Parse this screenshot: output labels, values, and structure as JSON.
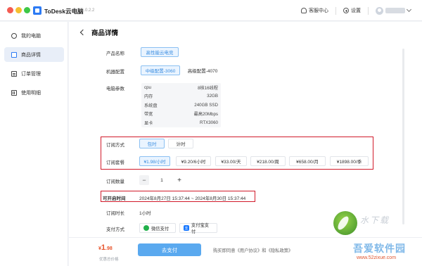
{
  "titlebar": {
    "app_name": "ToDesk云电脑",
    "version": "V1.0.2.2",
    "support": "客服中心",
    "settings": "设置"
  },
  "sidebar": {
    "items": [
      {
        "label": "我的电脑",
        "icon": "user-icon"
      },
      {
        "label": "商品详情",
        "icon": "detail-icon",
        "active": true
      },
      {
        "label": "订单管理",
        "icon": "order-icon"
      },
      {
        "label": "使用明细",
        "icon": "usage-icon"
      }
    ]
  },
  "page": {
    "title": "商品详情",
    "product_name_label": "产品名称",
    "product_name_value": "高性能云电竞",
    "machine_config_label": "机器配置",
    "config_options": [
      "中级配置-3060",
      "高级配置-4070"
    ],
    "selected_config": "中级配置-3060",
    "params_label": "电脑参数",
    "params": [
      {
        "name": "cpu",
        "value": "8核16线程"
      },
      {
        "name": "内存",
        "value": "32GB"
      },
      {
        "name": "系统盘",
        "value": "240GB SSD"
      },
      {
        "name": "带宽",
        "value": "最高20Mbps"
      },
      {
        "name": "显卡",
        "value": "RTX3060"
      }
    ],
    "sub_method_label": "订阅方式",
    "sub_methods": [
      "包时",
      "计时"
    ],
    "selected_method": "包时",
    "package_label": "订阅套餐",
    "packages": [
      "¥1.98/小时",
      "¥9.20/6小时",
      "¥33.00/天",
      "¥218.00/周",
      "¥658.00/月",
      "¥1898.00/季"
    ],
    "selected_package": "¥1.98/小时",
    "quantity_label": "订阅数量",
    "quantity": "1",
    "start_time_label": "可开启时间",
    "start_time_value": "2024年8月27日 15:37:44 ~ 2024年8月30日 15:37:44",
    "duration_label": "订阅时长",
    "duration_value": "1小时",
    "pay_label": "支付方式",
    "pay_methods": [
      "微信支付",
      "支付宝支付"
    ]
  },
  "footer": {
    "currency": "¥",
    "price_int": "1",
    "price_dec": ".98",
    "price_note": "优惠总价格",
    "buy_label": "去支付",
    "agreement": "购买即同意《用户协议》和《隐私政策》"
  },
  "watermark": {
    "top": "水下载",
    "main": "吾爱软件园",
    "url": "www.52zixue.com"
  },
  "colors": {
    "accent": "#2d7bf4",
    "selected_border": "#8bc0f2",
    "price": "#e8562e",
    "highlight_box": "#d11a2a"
  }
}
